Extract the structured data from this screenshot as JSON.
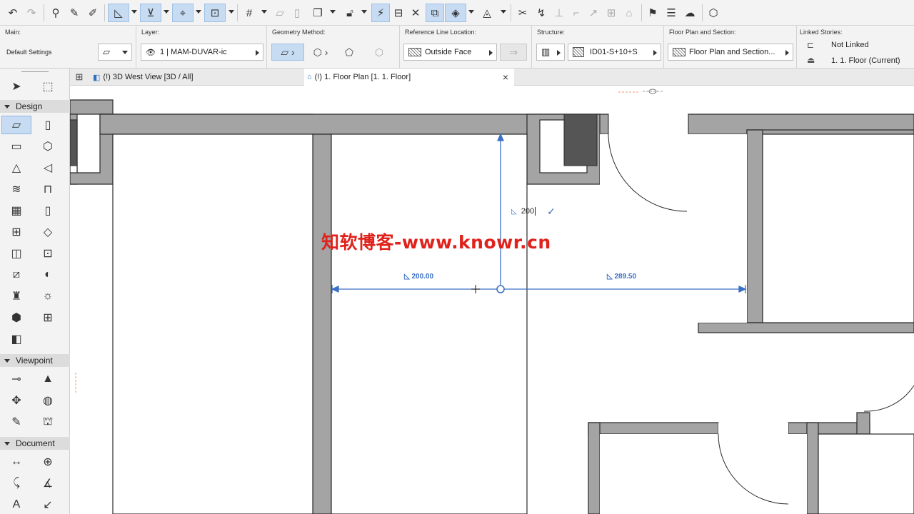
{
  "toolbar": {
    "buttons": [
      "undo-icon",
      "redo-icon",
      "pick-up-icon",
      "eyedropper-icon",
      "inject-icon",
      "guide-lines-icon",
      "snap-guides-icon",
      "snap-points-icon",
      "suspend-groups-icon",
      "grid-snap-icon",
      "trace-icon",
      "view-icon",
      "layer-icon",
      "lock-icon",
      "magic-wand-icon",
      "dimensions-icon",
      "intersect-icon",
      "arrange-icon",
      "rotate-icon",
      "mirror-icon",
      "split-icon",
      "adjust-icon",
      "elevate-icon",
      "offset-icon",
      "fillet-icon",
      "explode-icon",
      "roof-icon",
      "flag-icon",
      "layout-icon",
      "teamwork-icon",
      "publish-icon"
    ]
  },
  "infobox": {
    "main": {
      "title": "Main:",
      "value": "Default Settings"
    },
    "layer": {
      "title": "Layer:",
      "value": "1 | MAM-DUVAR-ic"
    },
    "geometry": {
      "title": "Geometry Method:"
    },
    "reference": {
      "title": "Reference Line Location:",
      "value": "Outside Face"
    },
    "structure": {
      "title": "Structure:",
      "value": "ID01-S+10+S"
    },
    "floorplan": {
      "title": "Floor Plan and Section:",
      "value": "Floor Plan and Section..."
    },
    "linked": {
      "title": "Linked Stories:",
      "top": "Not Linked",
      "bottom": "1. 1. Floor (Current)"
    }
  },
  "toolbox": {
    "groups": {
      "design": "Design",
      "viewpoint": "Viewpoint",
      "document": "Document"
    }
  },
  "tabs": [
    {
      "label": "(!) 3D West View [3D / All]"
    },
    {
      "label": "(!) 1. Floor Plan [1. 1. Floor]"
    }
  ],
  "tab_close": "×",
  "canvas": {
    "watermark": "知软博客-www.knowr.cn",
    "dims": {
      "left": "200.00",
      "right": "289.50",
      "input": "200"
    }
  }
}
